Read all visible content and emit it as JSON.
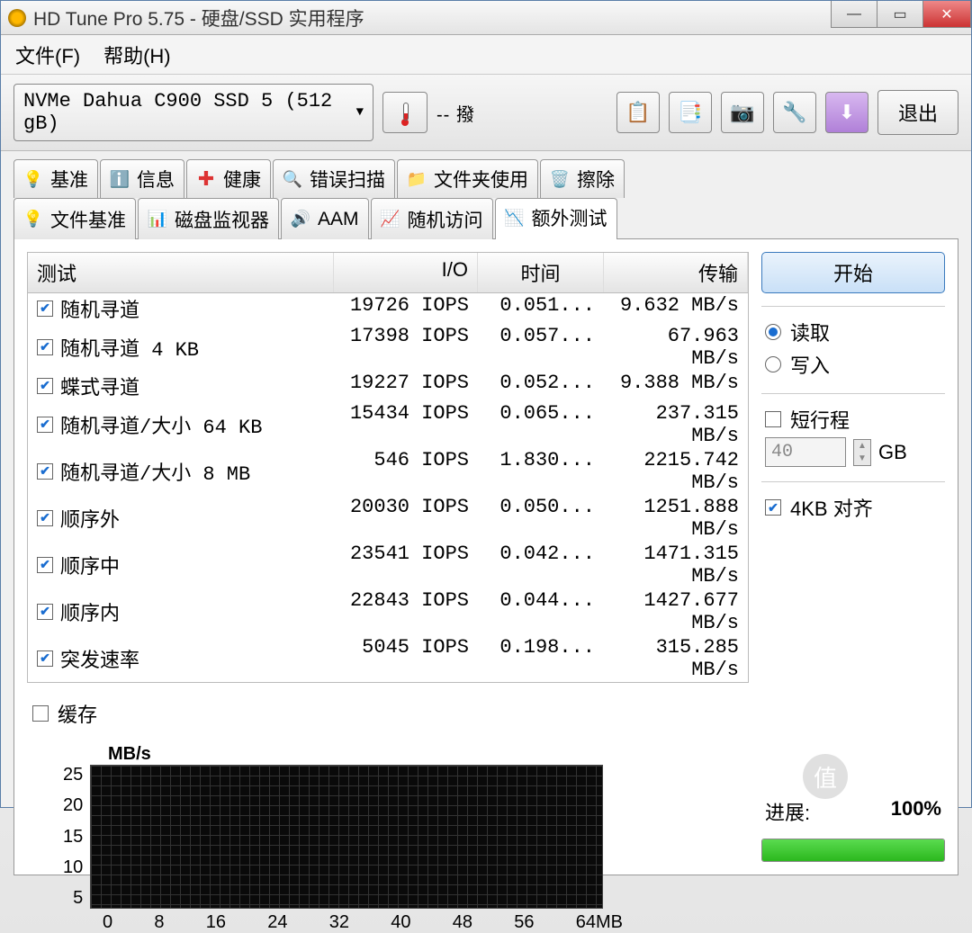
{
  "window": {
    "title": "HD Tune Pro 5.75 - 硬盘/SSD 实用程序"
  },
  "menu": {
    "file": "文件(F)",
    "help": "帮助(H)"
  },
  "toolbar": {
    "drive": "NVMe  Dahua C900 SSD 5 (512 gB)",
    "temp": "-- 撥",
    "exit": "退出"
  },
  "tabs_top": [
    {
      "icon": "bulb",
      "label": "基准"
    },
    {
      "icon": "info",
      "label": "信息"
    },
    {
      "icon": "plus",
      "label": "健康"
    },
    {
      "icon": "scan",
      "label": "错误扫描"
    },
    {
      "icon": "folder",
      "label": "文件夹使用"
    },
    {
      "icon": "trash",
      "label": "擦除"
    }
  ],
  "tabs_bottom": [
    {
      "icon": "bulb2",
      "label": "文件基准"
    },
    {
      "icon": "chart",
      "label": "磁盘监视器"
    },
    {
      "icon": "speaker",
      "label": "AAM"
    },
    {
      "icon": "random",
      "label": "随机访问"
    },
    {
      "icon": "extra",
      "label": "额外测试",
      "active": true
    }
  ],
  "table": {
    "headers": {
      "test": "测试",
      "io": "I/O",
      "time": "时间",
      "transfer": "传输"
    },
    "rows": [
      {
        "checked": true,
        "name": "随机寻道",
        "io": "19726 IOPS",
        "time": "0.051...",
        "tr": "9.632 MB/s"
      },
      {
        "checked": true,
        "name": "随机寻道 4 KB",
        "io": "17398 IOPS",
        "time": "0.057...",
        "tr": "67.963 MB/s"
      },
      {
        "checked": true,
        "name": "蝶式寻道",
        "io": "19227 IOPS",
        "time": "0.052...",
        "tr": "9.388 MB/s"
      },
      {
        "checked": true,
        "name": "随机寻道/大小 64 KB",
        "io": "15434 IOPS",
        "time": "0.065...",
        "tr": "237.315 MB/s"
      },
      {
        "checked": true,
        "name": "随机寻道/大小 8 MB",
        "io": "546 IOPS",
        "time": "1.830...",
        "tr": "2215.742 MB/s"
      },
      {
        "checked": true,
        "name": "顺序外",
        "io": "20030 IOPS",
        "time": "0.050...",
        "tr": "1251.888 MB/s"
      },
      {
        "checked": true,
        "name": "顺序中",
        "io": "23541 IOPS",
        "time": "0.042...",
        "tr": "1471.315 MB/s"
      },
      {
        "checked": true,
        "name": "顺序内",
        "io": "22843 IOPS",
        "time": "0.044...",
        "tr": "1427.677 MB/s"
      },
      {
        "checked": true,
        "name": "突发速率",
        "io": "5045 IOPS",
        "time": "0.198...",
        "tr": "315.285 MB/s"
      }
    ],
    "cache": {
      "checked": false,
      "label": "缓存"
    }
  },
  "controls": {
    "start": "开始",
    "read": "读取",
    "write": "写入",
    "short_stroke": "短行程",
    "short_stroke_value": "40",
    "short_stroke_unit": "GB",
    "align4kb": "4KB 对齐",
    "progress_label": "进展:",
    "progress_value": "100%",
    "progress_pct": 100
  },
  "chart_data": {
    "type": "bar",
    "title": "",
    "ylabel": "MB/s",
    "xlabel": "MB",
    "y_ticks": [
      5,
      10,
      15,
      20,
      25
    ],
    "x_ticks": [
      "0",
      "8",
      "16",
      "24",
      "32",
      "40",
      "48",
      "56",
      "64MB"
    ],
    "categories": [],
    "values": []
  },
  "watermark": "什么值得买"
}
